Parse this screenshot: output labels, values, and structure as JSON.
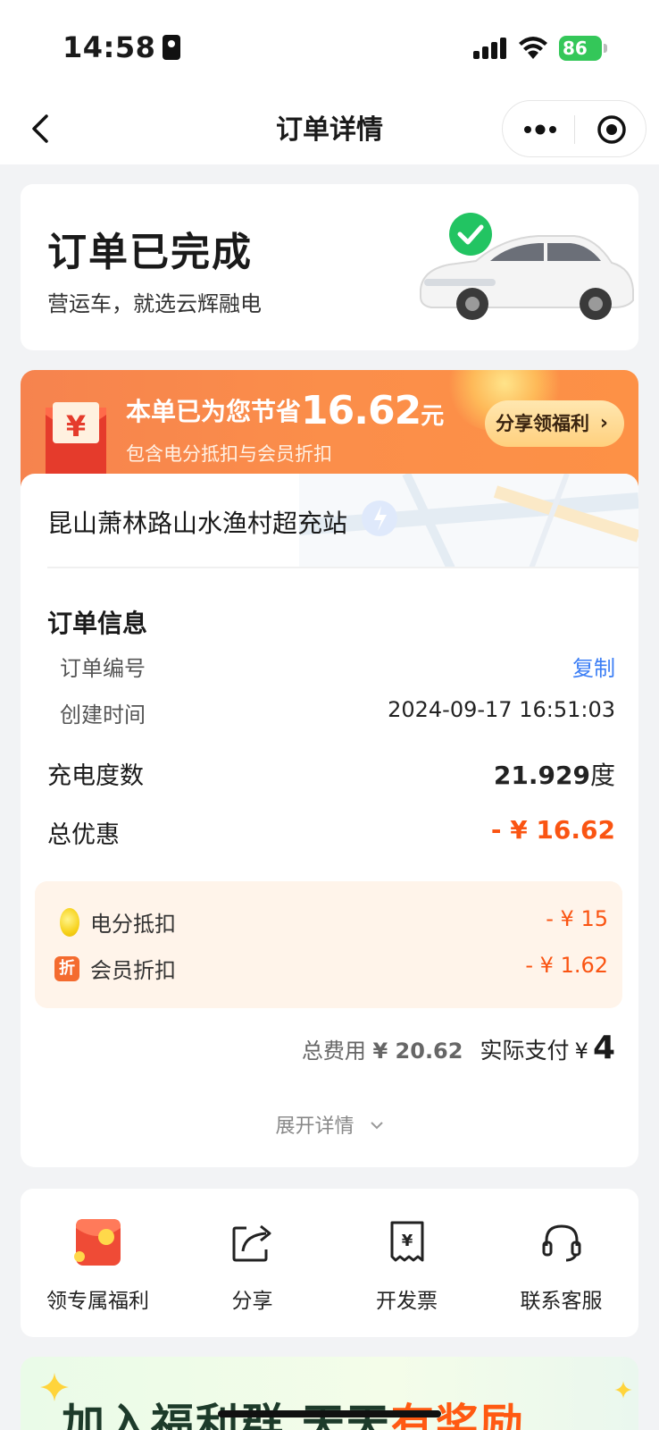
{
  "status_bar": {
    "time": "14:58",
    "battery": "86"
  },
  "nav": {
    "title": "订单详情"
  },
  "status_card": {
    "title": "订单已完成",
    "subtitle": "营运车，就选云辉融电"
  },
  "savings": {
    "prefix": "本单已为您节省",
    "amount": "16.62",
    "unit": "元",
    "subtitle": "包含电分抵扣与会员折扣",
    "share_label": "分享领福利",
    "currency_icon": "¥"
  },
  "station": {
    "name": "昆山萧林路山水渔村超充站"
  },
  "order_info": {
    "section_title": "订单信息",
    "order_no_label": "订单编号",
    "copy_label": "复制",
    "created_label": "创建时间",
    "created_value": "2024-09-17 16:51:03",
    "kwh_label": "充电度数",
    "kwh_value": "21.929",
    "kwh_unit": "度",
    "discount_label": "总优惠",
    "discount_value": "- ¥ 16.62"
  },
  "breakdown": {
    "points_label": "电分抵扣",
    "points_value": "- ¥ 15",
    "member_icon": "折",
    "member_label": "会员折扣",
    "member_value": "- ¥ 1.62"
  },
  "totals": {
    "total_label": "总费用",
    "total_value": "¥ 20.62",
    "paid_label": "实际支付",
    "paid_currency": "¥",
    "paid_value": "4"
  },
  "expand_label": "展开详情",
  "actions": [
    {
      "label": "领专属福利",
      "icon": "red-envelope-icon"
    },
    {
      "label": "分享",
      "icon": "share-icon"
    },
    {
      "label": "开发票",
      "icon": "invoice-icon"
    },
    {
      "label": "联系客服",
      "icon": "headset-icon"
    }
  ],
  "promo": {
    "text_a": "加入福利群 天天",
    "text_b": "有奖励"
  },
  "colors": {
    "accent_orange": "#fa5412",
    "link_blue": "#3a7df5",
    "battery_green": "#34c759"
  }
}
